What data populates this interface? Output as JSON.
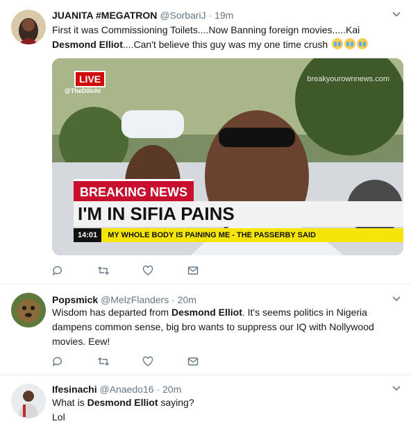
{
  "tweets": [
    {
      "name": "JUANITA #MEGATRON",
      "handle": "@SorbariJ",
      "time": "19m",
      "text_before": "First it was Commissioning Toilets....Now Banning foreign movies.....Kai ",
      "text_bold": "Desmond Elliot",
      "text_after": "....Can't believe this guy was my one time crush ",
      "media": {
        "live": "LIVE",
        "channel": "@TheDilichi",
        "watermark": "breakyourownnews.com",
        "banner": "BREAKING NEWS",
        "headline": "I'M IN SIFIA PAINS",
        "clock": "14:01",
        "ticker": "MY WHOLE BODY IS PAINING ME - THE PASSERBY SAID"
      }
    },
    {
      "name": "Popsmick",
      "handle": "@MelzFlanders",
      "time": "20m",
      "text_before": "Wisdom has departed from ",
      "text_bold": "Desmond Elliot",
      "text_after": ". It's seems politics in Nigeria dampens common sense, big bro wants to suppress our IQ with Nollywood movies. Eew!"
    },
    {
      "name": "Ifesinachi",
      "handle": "@Anaedo16",
      "time": "20m",
      "text_before": "What is ",
      "text_bold": "Desmond Elliot",
      "text_after": " saying?",
      "text_line2": "Lol"
    }
  ],
  "separator": "·",
  "colors": {
    "icon": "#657786",
    "border": "#e6ecf0",
    "breaking_red": "#c8102e",
    "ticker_yellow": "#f5e50a"
  }
}
